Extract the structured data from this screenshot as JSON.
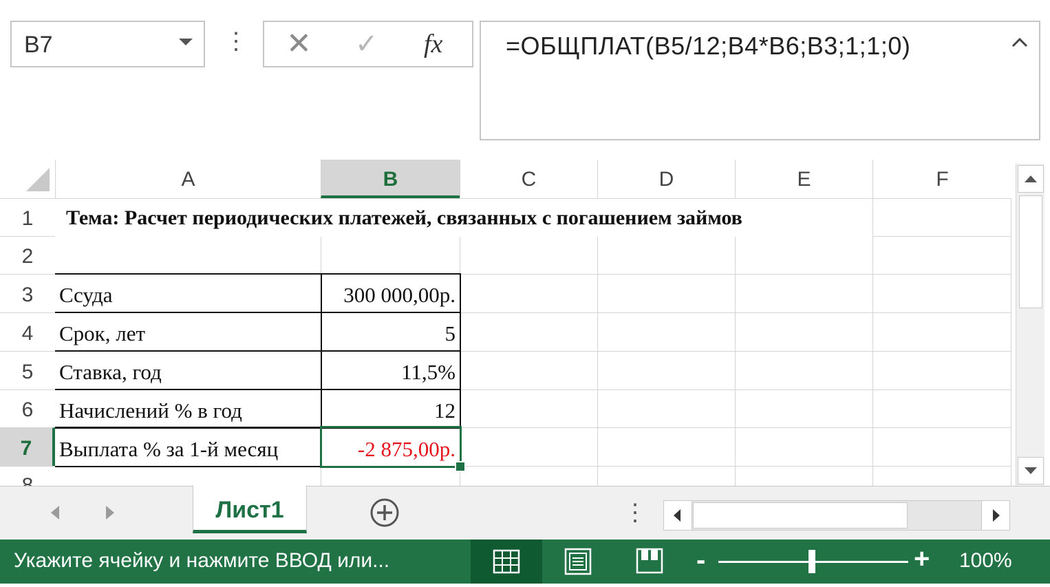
{
  "formula_bar": {
    "name_box": "B7",
    "cancel_icon": "✕",
    "enter_icon": "✓",
    "fx_label": "fx",
    "formula": "=ОБЩПЛАТ(B5/12;B4*B6;B3;1;1;0)"
  },
  "columns": [
    "A",
    "B",
    "C",
    "D",
    "E",
    "F"
  ],
  "selected_column": "B",
  "rows": [
    "1",
    "2",
    "3",
    "4",
    "5",
    "6",
    "7",
    "8"
  ],
  "selected_row": "7",
  "cells": {
    "A1": "Тема: Расчет периодических платежей, связанных с погашением займов",
    "A3": "Ссуда",
    "B3": "300 000,00р.",
    "A4": "Срок, лет",
    "B4": "5",
    "A5": "Ставка, год",
    "B5": "11,5%",
    "A6": "Начислений % в год",
    "B6": "12",
    "A7": "Выплата % за 1-й месяц",
    "B7": "-2 875,00р."
  },
  "sheet_tabs": {
    "active": "Лист1",
    "add_icon": "plus-circle-icon"
  },
  "status_bar": {
    "message": "Укажите ячейку и нажмите ВВОД или...",
    "zoom_out": "-",
    "zoom_in": "+",
    "zoom": "100%",
    "zoom_fraction": 0.5
  },
  "colors": {
    "accent": "#217346",
    "negative": "#e8121c"
  }
}
